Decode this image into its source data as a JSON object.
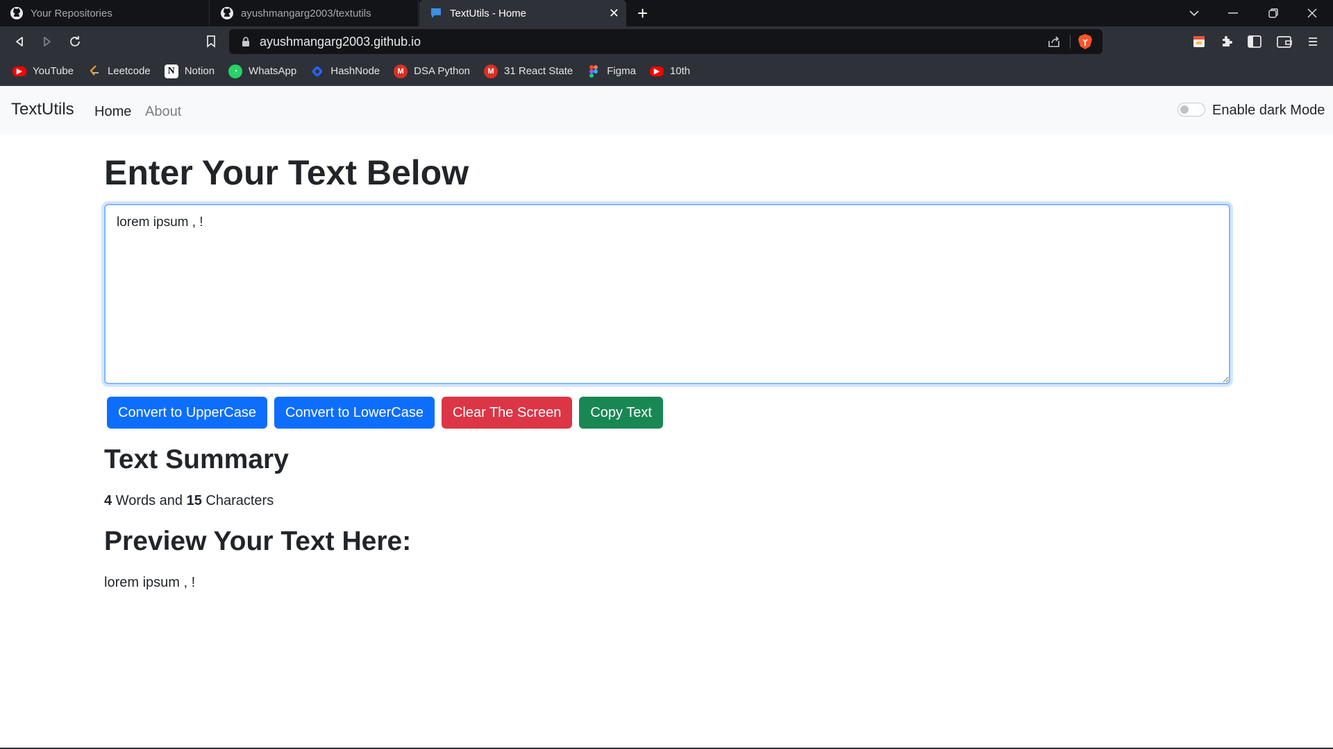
{
  "browser": {
    "tabs": [
      {
        "title": "Your Repositories",
        "icon": "github-icon"
      },
      {
        "title": "ayushmangarg2003/textutils",
        "icon": "github-icon"
      },
      {
        "title": "TextUtils - Home",
        "icon": "chat-icon",
        "active": true
      }
    ],
    "url": "ayushmangarg2003.github.io",
    "bookmarks": [
      {
        "label": "YouTube",
        "icon": "youtube-icon",
        "color": "#ff0000"
      },
      {
        "label": "Leetcode",
        "icon": "leetcode-icon",
        "color": "#ffa116"
      },
      {
        "label": "Notion",
        "icon": "notion-icon",
        "color": "#ffffff"
      },
      {
        "label": "WhatsApp",
        "icon": "whatsapp-icon",
        "color": "#25d366"
      },
      {
        "label": "HashNode",
        "icon": "hashnode-icon",
        "color": "#2962ff"
      },
      {
        "label": "DSA Python",
        "icon": "gmail-icon",
        "color": "#d93025"
      },
      {
        "label": "31 React State",
        "icon": "gmail-icon",
        "color": "#d93025"
      },
      {
        "label": "Figma",
        "icon": "figma-icon",
        "color": "#a259ff"
      },
      {
        "label": "10th",
        "icon": "youtube-icon",
        "color": "#ff0000"
      }
    ]
  },
  "navbar": {
    "brand": "TextUtils",
    "links": [
      "Home",
      "About"
    ],
    "dark_mode_label": "Enable dark Mode",
    "dark_mode_on": false
  },
  "main": {
    "heading": "Enter Your Text Below",
    "textarea_value": "lorem ipsum , !",
    "buttons": {
      "upper": "Convert to UpperCase",
      "lower": "Convert to LowerCase",
      "clear": "Clear The Screen",
      "copy": "Copy Text"
    },
    "summary_heading": "Text Summary",
    "word_count": "4",
    "words_label": " Words and ",
    "char_count": "15",
    "chars_label": " Characters",
    "preview_heading": "Preview Your Text Here:",
    "preview_text": "lorem ipsum , !"
  },
  "colors": {
    "primary": "#0d6efd",
    "danger": "#dc3545",
    "success": "#198754"
  }
}
